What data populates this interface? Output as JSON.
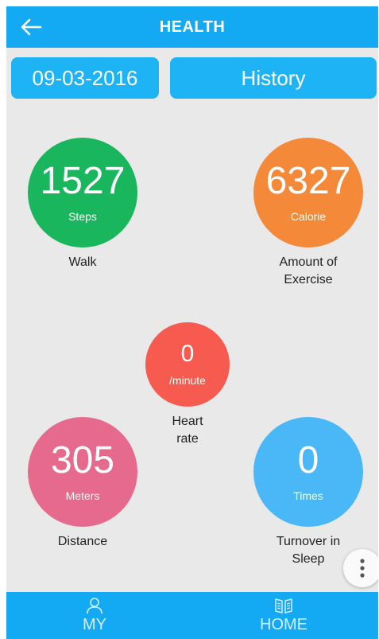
{
  "header": {
    "title": "HEALTH"
  },
  "date_button": {
    "label": "09-03-2016"
  },
  "history_button": {
    "label": "History"
  },
  "metrics": {
    "walk": {
      "value": "1527",
      "unit": "Steps",
      "label": "Walk",
      "color": "#19b65d"
    },
    "exercise": {
      "value": "6327",
      "unit": "Calorie",
      "label": "Amount of Exercise",
      "color": "#f5893a"
    },
    "heart": {
      "value": "0",
      "unit": "/minute",
      "label": "Heart rate",
      "color": "#f75a4f"
    },
    "distance": {
      "value": "305",
      "unit": "Meters",
      "label": "Distance",
      "color": "#e56a8d"
    },
    "sleep": {
      "value": "0",
      "unit": "Times",
      "label": "Turnover in Sleep",
      "color": "#4ab8f7"
    }
  },
  "bottom_nav": [
    {
      "label": "MY",
      "icon": "person-icon"
    },
    {
      "label": "HOME",
      "icon": "home-icon"
    }
  ],
  "colors": {
    "primary": "#14aaf3",
    "background": "#e9e9e9"
  }
}
